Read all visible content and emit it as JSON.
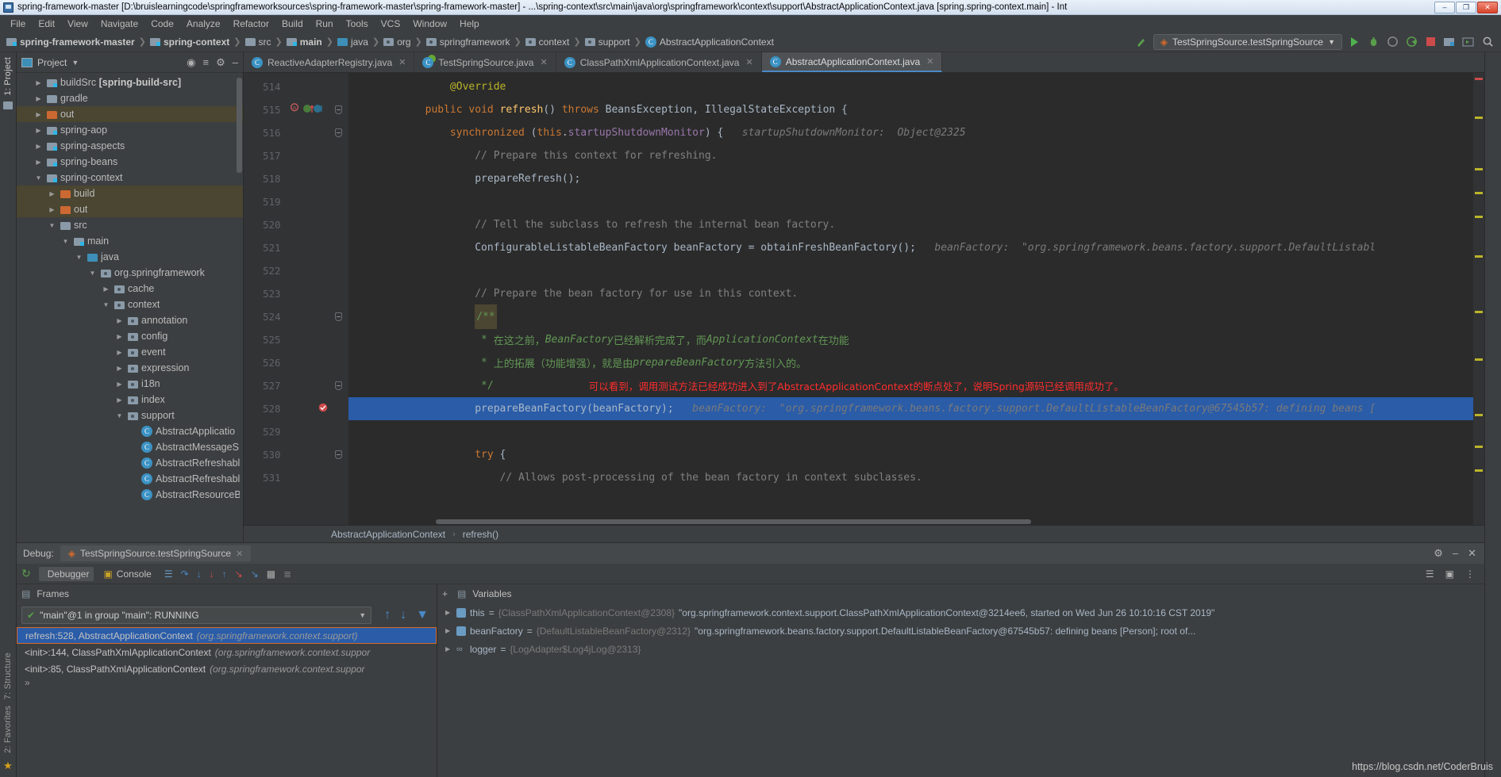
{
  "window": {
    "title": "spring-framework-master [D:\\bruislearningcode\\springframeworksources\\spring-framework-master\\spring-framework-master] - ...\\spring-context\\src\\main\\java\\org\\springframework\\context\\support\\AbstractApplicationContext.java [spring.spring-context.main] - Int",
    "minimize": "–",
    "maximize": "❐",
    "close": "✕"
  },
  "menubar": [
    "File",
    "Edit",
    "View",
    "Navigate",
    "Code",
    "Analyze",
    "Refactor",
    "Build",
    "Run",
    "Tools",
    "VCS",
    "Window",
    "Help"
  ],
  "breadcrumb": [
    {
      "label": "spring-framework-master",
      "icon": "module-folder-icon",
      "bold": true
    },
    {
      "label": "spring-context",
      "icon": "module-folder-icon",
      "bold": true
    },
    {
      "label": "src",
      "icon": "folder-icon",
      "bold": false
    },
    {
      "label": "main",
      "icon": "module-folder-icon",
      "bold": true
    },
    {
      "label": "java",
      "icon": "source-folder-icon",
      "bold": false
    },
    {
      "label": "org",
      "icon": "package-icon",
      "bold": false
    },
    {
      "label": "springframework",
      "icon": "package-icon",
      "bold": false
    },
    {
      "label": "context",
      "icon": "package-icon",
      "bold": false
    },
    {
      "label": "support",
      "icon": "package-icon",
      "bold": false
    },
    {
      "label": "AbstractApplicationContext",
      "icon": "class-icon",
      "bold": false
    }
  ],
  "toolbar": {
    "run_config": "TestSpringSource.testSpringSource",
    "run_label": "Run",
    "debug_label": "Debug",
    "coverage_label": "Run with Coverage",
    "profile_label": "Profile",
    "stop_label": "Stop",
    "build_label": "Build Project",
    "search_label": "Search Everywhere"
  },
  "project_panel": {
    "title": "Project",
    "locate_icon": "crosshair-icon",
    "collapse_icon": "collapse-all-icon",
    "settings_icon": "gear-icon",
    "hide_icon": "hide-icon",
    "tree": [
      {
        "label": "buildSrc ",
        "bold": "[spring-build-src]",
        "depth": 1,
        "twisty": "▶",
        "icon": "module-folder-icon",
        "highlight": false
      },
      {
        "label": "gradle",
        "bold": "",
        "depth": 1,
        "twisty": "▶",
        "icon": "folder-icon",
        "highlight": false
      },
      {
        "label": "out",
        "bold": "",
        "depth": 1,
        "twisty": "▶",
        "icon": "out-folder-icon",
        "highlight": true
      },
      {
        "label": "spring-aop",
        "bold": "",
        "depth": 1,
        "twisty": "▶",
        "icon": "module-folder-icon",
        "highlight": false
      },
      {
        "label": "spring-aspects",
        "bold": "",
        "depth": 1,
        "twisty": "▶",
        "icon": "module-folder-icon",
        "highlight": false
      },
      {
        "label": "spring-beans",
        "bold": "",
        "depth": 1,
        "twisty": "▶",
        "icon": "module-folder-icon",
        "highlight": false
      },
      {
        "label": "spring-context",
        "bold": "",
        "depth": 1,
        "twisty": "▼",
        "icon": "module-folder-icon",
        "highlight": false
      },
      {
        "label": "build",
        "bold": "",
        "depth": 2,
        "twisty": "▶",
        "icon": "out-folder-icon",
        "highlight": true
      },
      {
        "label": "out",
        "bold": "",
        "depth": 2,
        "twisty": "▶",
        "icon": "out-folder-icon",
        "highlight": true
      },
      {
        "label": "src",
        "bold": "",
        "depth": 2,
        "twisty": "▼",
        "icon": "folder-icon",
        "highlight": false
      },
      {
        "label": "main",
        "bold": "",
        "depth": 3,
        "twisty": "▼",
        "icon": "module-folder-icon",
        "highlight": false
      },
      {
        "label": "java",
        "bold": "",
        "depth": 4,
        "twisty": "▼",
        "icon": "source-folder-icon",
        "highlight": false
      },
      {
        "label": "org.springframework",
        "bold": "",
        "depth": 5,
        "twisty": "▼",
        "icon": "package-icon",
        "highlight": false
      },
      {
        "label": "cache",
        "bold": "",
        "depth": 6,
        "twisty": "▶",
        "icon": "package-icon",
        "highlight": false
      },
      {
        "label": "context",
        "bold": "",
        "depth": 6,
        "twisty": "▼",
        "icon": "package-icon",
        "highlight": false
      },
      {
        "label": "annotation",
        "bold": "",
        "depth": 7,
        "twisty": "▶",
        "icon": "package-icon",
        "highlight": false
      },
      {
        "label": "config",
        "bold": "",
        "depth": 7,
        "twisty": "▶",
        "icon": "package-icon",
        "highlight": false
      },
      {
        "label": "event",
        "bold": "",
        "depth": 7,
        "twisty": "▶",
        "icon": "package-icon",
        "highlight": false
      },
      {
        "label": "expression",
        "bold": "",
        "depth": 7,
        "twisty": "▶",
        "icon": "package-icon",
        "highlight": false
      },
      {
        "label": "i18n",
        "bold": "",
        "depth": 7,
        "twisty": "▶",
        "icon": "package-icon",
        "highlight": false
      },
      {
        "label": "index",
        "bold": "",
        "depth": 7,
        "twisty": "▶",
        "icon": "package-icon",
        "highlight": false
      },
      {
        "label": "support",
        "bold": "",
        "depth": 7,
        "twisty": "▼",
        "icon": "package-icon",
        "highlight": false
      },
      {
        "label": "AbstractApplicatio",
        "bold": "",
        "depth": 8,
        "twisty": "",
        "icon": "class-icon",
        "highlight": false
      },
      {
        "label": "AbstractMessageS",
        "bold": "",
        "depth": 8,
        "twisty": "",
        "icon": "class-icon",
        "highlight": false
      },
      {
        "label": "AbstractRefreshabl",
        "bold": "",
        "depth": 8,
        "twisty": "",
        "icon": "class-icon",
        "highlight": false
      },
      {
        "label": "AbstractRefreshabl",
        "bold": "",
        "depth": 8,
        "twisty": "",
        "icon": "class-icon",
        "highlight": false
      },
      {
        "label": "AbstractResourceB",
        "bold": "",
        "depth": 8,
        "twisty": "",
        "icon": "class-icon",
        "highlight": false
      }
    ]
  },
  "left_strip": {
    "project": "1: Project",
    "structure": "7: Structure",
    "favorites": "2: Favorites"
  },
  "editor_tabs": [
    {
      "label": "ReactiveAdapterRegistry.java",
      "active": false,
      "close": "✕"
    },
    {
      "label": "TestSpringSource.java",
      "active": false,
      "close": "✕"
    },
    {
      "label": "ClassPathXmlApplicationContext.java",
      "active": false,
      "close": "✕"
    },
    {
      "label": "AbstractApplicationContext.java",
      "active": true,
      "close": "✕"
    }
  ],
  "editor": {
    "breadcrumb_class": "AbstractApplicationContext",
    "breadcrumb_method": "refresh()",
    "lines": [
      {
        "num": "514",
        "fold": false,
        "gutter_icons": [],
        "selected": false,
        "segments": [
          {
            "t": "            ",
            "c": "txt"
          },
          {
            "t": "@Override",
            "c": "anno"
          }
        ]
      },
      {
        "num": "515",
        "fold": true,
        "gutter_icons": [
          "method-override-icon",
          "breakpoint-field-icons"
        ],
        "selected": false,
        "segments": [
          {
            "t": "        ",
            "c": "txt"
          },
          {
            "t": "public",
            "c": "kw"
          },
          {
            "t": " ",
            "c": "txt"
          },
          {
            "t": "void",
            "c": "kw"
          },
          {
            "t": " ",
            "c": "txt"
          },
          {
            "t": "refresh",
            "c": "fn"
          },
          {
            "t": "() ",
            "c": "txt"
          },
          {
            "t": "throws",
            "c": "kw"
          },
          {
            "t": " BeansException, IllegalStateException {",
            "c": "txt"
          }
        ]
      },
      {
        "num": "516",
        "fold": true,
        "gutter_icons": [],
        "selected": false,
        "segments": [
          {
            "t": "            ",
            "c": "txt"
          },
          {
            "t": "synchronized",
            "c": "kw"
          },
          {
            "t": " (",
            "c": "txt"
          },
          {
            "t": "this",
            "c": "kw"
          },
          {
            "t": ".",
            "c": "txt"
          },
          {
            "t": "startupShutdownMonitor",
            "c": "fld"
          },
          {
            "t": ") {   ",
            "c": "txt"
          },
          {
            "t": "startupShutdownMonitor:  Object@2325",
            "c": "hintv"
          }
        ]
      },
      {
        "num": "517",
        "fold": false,
        "gutter_icons": [],
        "selected": false,
        "segments": [
          {
            "t": "                ",
            "c": "txt"
          },
          {
            "t": "// Prepare this context for refreshing.",
            "c": "cmt"
          }
        ]
      },
      {
        "num": "518",
        "fold": false,
        "gutter_icons": [],
        "selected": false,
        "segments": [
          {
            "t": "                ",
            "c": "txt"
          },
          {
            "t": "prepareRefresh",
            "c": "txt"
          },
          {
            "t": "();",
            "c": "txt"
          }
        ]
      },
      {
        "num": "519",
        "fold": false,
        "gutter_icons": [],
        "selected": false,
        "segments": []
      },
      {
        "num": "520",
        "fold": false,
        "gutter_icons": [],
        "selected": false,
        "segments": [
          {
            "t": "                ",
            "c": "txt"
          },
          {
            "t": "// Tell the subclass to refresh the internal bean factory.",
            "c": "cmt"
          }
        ]
      },
      {
        "num": "521",
        "fold": false,
        "gutter_icons": [],
        "selected": false,
        "segments": [
          {
            "t": "                ConfigurableListableBeanFactory beanFactory = obtainFreshBeanFactory();   ",
            "c": "txt"
          },
          {
            "t": "beanFactory:  \"org.springframework.beans.factory.support.DefaultListabl",
            "c": "hintv"
          }
        ]
      },
      {
        "num": "522",
        "fold": false,
        "gutter_icons": [],
        "selected": false,
        "segments": []
      },
      {
        "num": "523",
        "fold": false,
        "gutter_icons": [],
        "selected": false,
        "segments": [
          {
            "t": "                ",
            "c": "txt"
          },
          {
            "t": "// Prepare the bean factory for use in this context.",
            "c": "cmt"
          }
        ]
      },
      {
        "num": "524",
        "fold": true,
        "gutter_icons": [],
        "selected": false,
        "highlight_box": "/**",
        "segments": [
          {
            "t": "                ",
            "c": "txt"
          }
        ]
      },
      {
        "num": "525",
        "fold": false,
        "gutter_icons": [],
        "selected": false,
        "segments": [
          {
            "t": "                 * ",
            "c": "jdocb"
          },
          {
            "t": "在这之前，",
            "c": "jdocb"
          },
          {
            "t": "BeanFactory",
            "c": "jdoc"
          },
          {
            "t": "已经解析完成了，而",
            "c": "jdocb"
          },
          {
            "t": "ApplicationContext",
            "c": "jdoc"
          },
          {
            "t": "在功能",
            "c": "jdocb"
          }
        ]
      },
      {
        "num": "526",
        "fold": false,
        "gutter_icons": [],
        "selected": false,
        "segments": [
          {
            "t": "                 * ",
            "c": "jdocb"
          },
          {
            "t": "上的拓展（功能增强），就是由",
            "c": "jdocb"
          },
          {
            "t": "prepareBeanFactory",
            "c": "jdoc"
          },
          {
            "t": "方法引入的。",
            "c": "jdocb"
          }
        ]
      },
      {
        "num": "527",
        "fold": true,
        "gutter_icons": [],
        "selected": false,
        "red_annotation": "可以看到，调用测试方法已经成功进入到了AbstractApplicationContext的断点处了，说明Spring源码已经调用成功了。",
        "segments": [
          {
            "t": "                 */",
            "c": "jdocb"
          }
        ]
      },
      {
        "num": "528",
        "fold": false,
        "gutter_icons": [
          "breakpoint-checked-icon"
        ],
        "selected": true,
        "segments": [
          {
            "t": "                prepareBeanFactory(beanFactory);   ",
            "c": "txt"
          },
          {
            "t": "beanFactory:  \"org.springframework.beans.factory.support.DefaultListableBeanFactory@67545b57: defining beans [",
            "c": "hintv"
          }
        ]
      },
      {
        "num": "529",
        "fold": false,
        "gutter_icons": [],
        "selected": false,
        "segments": []
      },
      {
        "num": "530",
        "fold": true,
        "gutter_icons": [],
        "selected": false,
        "segments": [
          {
            "t": "                ",
            "c": "txt"
          },
          {
            "t": "try",
            "c": "kw"
          },
          {
            "t": " {",
            "c": "txt"
          }
        ]
      },
      {
        "num": "531",
        "fold": false,
        "gutter_icons": [],
        "selected": false,
        "segments": [
          {
            "t": "                    ",
            "c": "txt"
          },
          {
            "t": "// Allows post-processing of the bean factory in context subclasses.",
            "c": "cmt"
          }
        ]
      }
    ]
  },
  "debug": {
    "label": "Debug:",
    "session": "TestSpringSource.testSpringSource",
    "session_close": "✕",
    "settings_icon": "gear-icon",
    "minimize_icon": "minimize-icon",
    "close_icon": "close-icon",
    "tabs": [
      {
        "label": "Debugger",
        "active": true,
        "icon": "debugger-icon"
      },
      {
        "label": "Console",
        "active": false,
        "icon": "console-icon"
      }
    ],
    "toolbar_icons": [
      "rerun-icon",
      "mute-breakpoints-icon",
      "step-over-icon",
      "step-into-icon",
      "force-step-into-icon",
      "step-out-icon",
      "drop-frame-icon",
      "run-to-cursor-icon",
      "evaluate-icon",
      "settings-icon"
    ],
    "frames": {
      "title": "Frames",
      "thread": "\"main\"@1 in group \"main\": RUNNING",
      "up_icon": "arrow-up-icon",
      "down_icon": "arrow-down-icon",
      "filter_icon": "filter-icon",
      "rows": [
        {
          "main": "refresh:528, AbstractApplicationContext",
          "sub": "(org.springframework.context.support)",
          "selected": true
        },
        {
          "main": "<init>:144, ClassPathXmlApplicationContext",
          "sub": "(org.springframework.context.suppor",
          "selected": false
        },
        {
          "main": "<init>:85, ClassPathXmlApplicationContext",
          "sub": "(org.springframework.context.suppor",
          "selected": false
        }
      ],
      "more": "»"
    },
    "variables": {
      "title": "Variables",
      "rows": [
        {
          "twisty": "▶",
          "icon": "object-icon",
          "name": "this",
          "eq": "=",
          "type": "{ClassPathXmlApplicationContext@2308}",
          "value": "\"org.springframework.context.support.ClassPathXmlApplicationContext@3214ee6, started on Wed Jun 26 10:10:16 CST 2019\""
        },
        {
          "twisty": "▶",
          "icon": "object-icon",
          "name": "beanFactory",
          "eq": "=",
          "type": "{DefaultListableBeanFactory@2312}",
          "value": "\"org.springframework.beans.factory.support.DefaultListableBeanFactory@67545b57: defining beans [Person]; root of..."
        },
        {
          "twisty": "▶",
          "icon": "chain-icon",
          "name": "logger",
          "eq": "=",
          "type": "{LogAdapter$Log4jLog@2313}",
          "value": ""
        }
      ]
    }
  },
  "watermark": "https://blog.csdn.net/CoderBruis"
}
